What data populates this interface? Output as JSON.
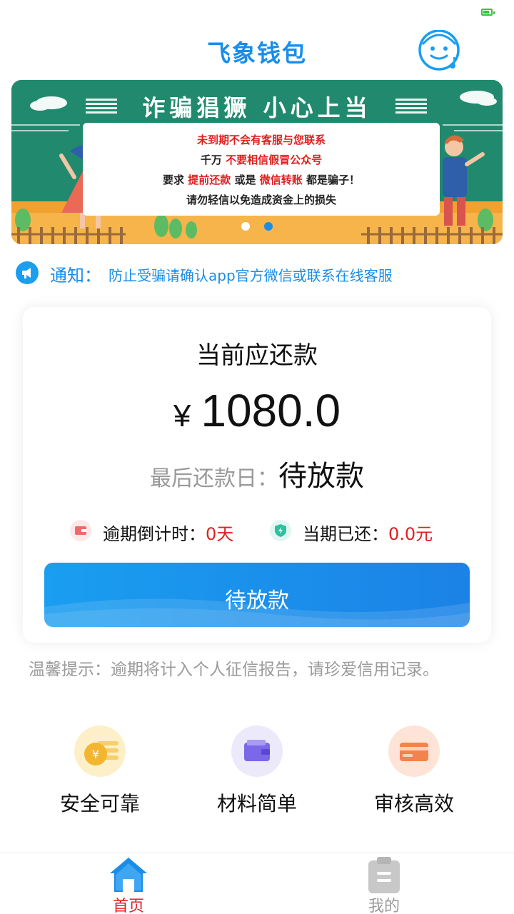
{
  "app": {
    "title": "飞象钱包"
  },
  "banner": {
    "title": "诈骗猖獗 小心上当",
    "line1": "未到期不会有客服与您联系",
    "line2_prefix": "千万",
    "line2_emphasis": "不要相信假冒公众号",
    "line3_prefix": "要求",
    "line3_emphasis1": "提前还款",
    "line3_middle": "或是",
    "line3_emphasis2": "微信转账",
    "line3_suffix": "都是骗子！",
    "line4": "请勿轻信以免造成资金上的损失",
    "active_slide": 2,
    "slide_count": 2
  },
  "notice": {
    "label": "通知：",
    "text": "防止受骗请确认app官方微信或联系在线客服"
  },
  "repayment": {
    "heading": "当前应还款",
    "currency_symbol": "¥",
    "amount": "1080.0",
    "due_label": "最后还款日：",
    "due_value": "待放款",
    "overdue_label": "逾期倒计时：",
    "overdue_value": "0天",
    "paid_label": "当期已还：",
    "paid_value": "0.0元",
    "button_label": "待放款"
  },
  "tip": "温馨提示：逾期将计入个人征信报告，请珍爱信用记录。",
  "features": [
    {
      "label": "安全可靠",
      "icon": "yen-coin-icon"
    },
    {
      "label": "材料简单",
      "icon": "wallet-icon"
    },
    {
      "label": "审核高效",
      "icon": "card-icon"
    }
  ],
  "tabs": [
    {
      "label": "首页",
      "icon": "home-icon",
      "active": true
    },
    {
      "label": "我的",
      "icon": "clipboard-icon",
      "active": false
    }
  ],
  "colors": {
    "accent": "#1a8de9",
    "warning": "#e02020",
    "inactive": "#999999"
  }
}
